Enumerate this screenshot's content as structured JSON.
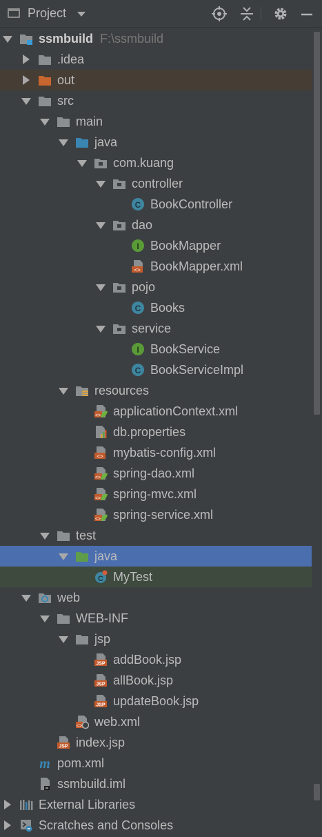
{
  "header": {
    "title": "Project",
    "buttons": [
      "locate-icon",
      "collapse-all-icon",
      "gear-icon",
      "minimize-icon"
    ]
  },
  "tree": [
    {
      "label": "ssmbuild",
      "path": "F:\\ssmbuild",
      "icon": "module-folder",
      "depth": 0,
      "arrow": "down",
      "bold": true
    },
    {
      "label": ".idea",
      "icon": "folder-gray",
      "depth": 1,
      "arrow": "right"
    },
    {
      "label": "out",
      "icon": "folder-orange",
      "depth": 1,
      "arrow": "right",
      "highlight": "orange"
    },
    {
      "label": "src",
      "icon": "folder-gray",
      "depth": 1,
      "arrow": "down"
    },
    {
      "label": "main",
      "icon": "folder-gray",
      "depth": 2,
      "arrow": "down"
    },
    {
      "label": "java",
      "icon": "folder-blue",
      "depth": 3,
      "arrow": "down"
    },
    {
      "label": "com.kuang",
      "icon": "package",
      "depth": 4,
      "arrow": "down"
    },
    {
      "label": "controller",
      "icon": "package",
      "depth": 5,
      "arrow": "down"
    },
    {
      "label": "BookController",
      "icon": "class",
      "depth": 6
    },
    {
      "label": "dao",
      "icon": "package",
      "depth": 5,
      "arrow": "down"
    },
    {
      "label": "BookMapper",
      "icon": "interface",
      "depth": 6
    },
    {
      "label": "BookMapper.xml",
      "icon": "xml",
      "depth": 6
    },
    {
      "label": "pojo",
      "icon": "package",
      "depth": 5,
      "arrow": "down"
    },
    {
      "label": "Books",
      "icon": "class",
      "depth": 6
    },
    {
      "label": "service",
      "icon": "package",
      "depth": 5,
      "arrow": "down"
    },
    {
      "label": "BookService",
      "icon": "interface",
      "depth": 6
    },
    {
      "label": "BookServiceImpl",
      "icon": "class",
      "depth": 6
    },
    {
      "label": "resources",
      "icon": "resources-folder",
      "depth": 3,
      "arrow": "down"
    },
    {
      "label": "applicationContext.xml",
      "icon": "spring-xml",
      "depth": 4
    },
    {
      "label": "db.properties",
      "icon": "properties",
      "depth": 4
    },
    {
      "label": "mybatis-config.xml",
      "icon": "xml",
      "depth": 4
    },
    {
      "label": "spring-dao.xml",
      "icon": "spring-xml",
      "depth": 4
    },
    {
      "label": "spring-mvc.xml",
      "icon": "spring-xml",
      "depth": 4
    },
    {
      "label": "spring-service.xml",
      "icon": "spring-xml",
      "depth": 4
    },
    {
      "label": "test",
      "icon": "folder-gray",
      "depth": 2,
      "arrow": "down"
    },
    {
      "label": "java",
      "icon": "folder-green",
      "depth": 3,
      "arrow": "down",
      "highlight": "selected"
    },
    {
      "label": "MyTest",
      "icon": "test-class",
      "depth": 4,
      "highlight": "green"
    },
    {
      "label": "web",
      "icon": "web-folder",
      "depth": 1,
      "arrow": "down"
    },
    {
      "label": "WEB-INF",
      "icon": "folder-gray",
      "depth": 2,
      "arrow": "down"
    },
    {
      "label": "jsp",
      "icon": "folder-gray",
      "depth": 3,
      "arrow": "down"
    },
    {
      "label": "addBook.jsp",
      "icon": "jsp",
      "depth": 4
    },
    {
      "label": "allBook.jsp",
      "icon": "jsp",
      "depth": 4
    },
    {
      "label": "updateBook.jsp",
      "icon": "jsp",
      "depth": 4
    },
    {
      "label": "web.xml",
      "icon": "web-xml",
      "depth": 3
    },
    {
      "label": "index.jsp",
      "icon": "jsp",
      "depth": 2
    },
    {
      "label": "pom.xml",
      "icon": "maven",
      "depth": 1
    },
    {
      "label": "ssmbuild.iml",
      "icon": "iml",
      "depth": 1
    },
    {
      "label": "External Libraries",
      "icon": "libraries",
      "depth": 0,
      "arrow": "right"
    },
    {
      "label": "Scratches and Consoles",
      "icon": "scratches",
      "depth": 0,
      "arrow": "right"
    }
  ],
  "colors": {
    "background": "#3c3f41",
    "selection": "#4b6eaf",
    "excluded_highlight": "#463d35",
    "test_highlight": "#3e4a3e",
    "folder_blue": "#3a86b3",
    "folder_orange": "#c7662f",
    "folder_green": "#5f9d4a",
    "class_blue": "#3e86a0",
    "interface_green": "#5a9b38"
  }
}
